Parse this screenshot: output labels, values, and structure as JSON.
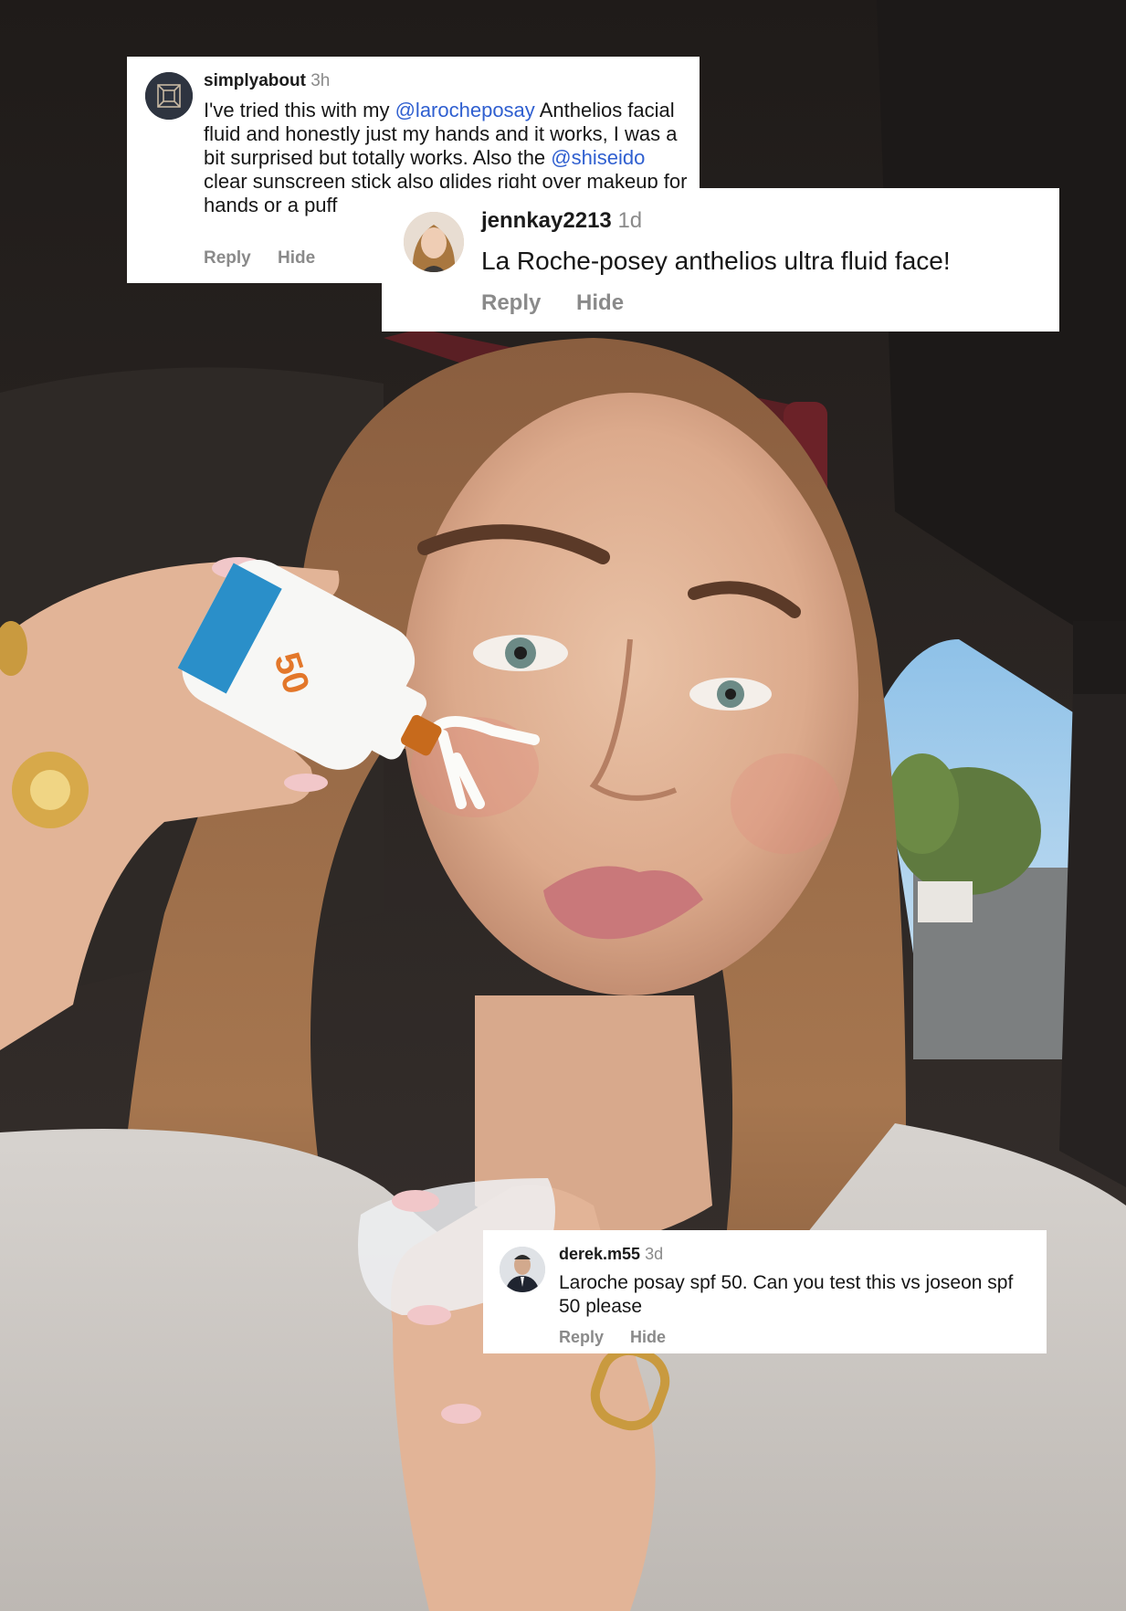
{
  "comments": [
    {
      "username": "simplyabout",
      "time": "3h",
      "text_parts": {
        "p1": "I've tried this with my ",
        "mention1": "@larocheposay",
        "p2": " Anthelios facial fluid and honestly just my hands and it works, I was a bit surprised but totally works. Also the ",
        "mention2": "@shiseido",
        "p3": " clear sunscreen stick also glides right over makeup for hands or a puff"
      },
      "reply_label": "Reply",
      "hide_label": "Hide"
    },
    {
      "username": "jennkay2213",
      "time": "1d",
      "text": "La Roche-posey anthelios ultra fluid face!",
      "reply_label": "Reply",
      "hide_label": "Hide"
    },
    {
      "username": "derek.m55",
      "time": "3d",
      "text": "Laroche posay spf 50. Can you test this vs joseon spf 50 please",
      "reply_label": "Reply",
      "hide_label": "Hide"
    }
  ],
  "product": {
    "spf_label": "50"
  },
  "colors": {
    "mention": "#2f5fd0",
    "muted_text": "#8a8a8a",
    "card_bg": "#ffffff"
  },
  "icons": [
    "hypercube-avatar-icon",
    "portrait-avatar-icon",
    "suit-portrait-avatar-icon"
  ]
}
